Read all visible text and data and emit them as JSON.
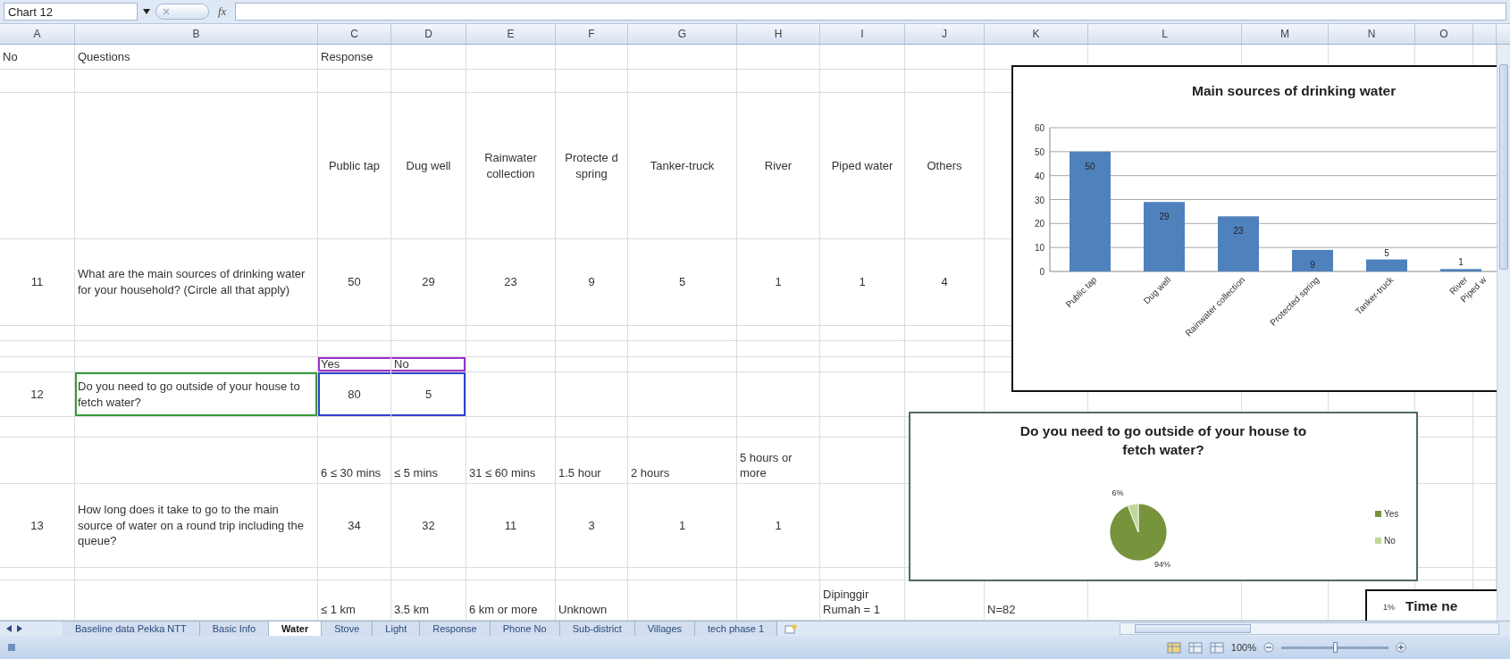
{
  "formula_bar": {
    "name_box": "Chart 12",
    "function_label": "fx"
  },
  "sheet": {
    "columns": [
      "A",
      "B",
      "C",
      "D",
      "E",
      "F",
      "G",
      "H",
      "I",
      "J",
      "K",
      "L",
      "M",
      "N",
      "O"
    ],
    "rows": [
      {
        "kind": "title",
        "A": "No",
        "B": "Questions",
        "C": "Response"
      },
      {
        "kind": "blank"
      },
      {
        "kind": "options",
        "C": "Public tap",
        "D": "Dug well",
        "E": "Rainwater collection",
        "F": "Protecte d spring",
        "G": "Tanker-truck",
        "H": "River",
        "I": "Piped water",
        "J": "Others"
      },
      {
        "kind": "answers",
        "A": "11",
        "B": "What are the main sources of drinking water for your household? (Circle all that apply)",
        "C": "50",
        "D": "29",
        "E": "23",
        "F": "9",
        "G": "5",
        "H": "1",
        "I": "1",
        "J": "4"
      },
      {
        "kind": "blank"
      },
      {
        "kind": "blank"
      },
      {
        "kind": "options_top",
        "C": "Yes",
        "D": "No",
        "highlight": {
          "C": {
            "color": "#9b30c8"
          },
          "D": {
            "color": "#9b30c8"
          }
        }
      },
      {
        "kind": "answers",
        "A": "12",
        "B": "Do you need to go outside of your house to fetch water?",
        "C": "80",
        "D": "5",
        "highlight": {
          "B": {
            "color": "#3a9a3a"
          },
          "C": {
            "color": "#3040d0"
          },
          "D": {
            "color": "#3040d0"
          }
        }
      },
      {
        "kind": "blank"
      },
      {
        "kind": "options_bottom",
        "C": "6 ≤ 30 mins",
        "D": "≤ 5 mins",
        "E": "31 ≤ 60 mins",
        "F": "1.5 hour",
        "G": "2 hours",
        "H": "5 hours or more"
      },
      {
        "kind": "answers",
        "A": "13",
        "B": "How long does it take to go to the main source of water on a round trip including the queue?",
        "C": "34",
        "D": "32",
        "E": "11",
        "F": "3",
        "G": "1",
        "H": "1"
      },
      {
        "kind": "blank"
      },
      {
        "kind": "options_bottom",
        "C": "≤ 1 km",
        "D": "3.5 km",
        "E": "6 km or more",
        "F": "Unknown",
        "I": "Dipinggir Rumah = 1",
        "K": "N=82"
      }
    ],
    "bar_chart": {
      "chart_data": {
        "type": "bar",
        "title": "Main sources of drinking water",
        "categories": [
          "Public tap",
          "Dug well",
          "Rainwater collection",
          "Protected spring",
          "Tanker-truck",
          "River",
          "Piped w"
        ],
        "series": [
          {
            "color": "#4f81bd",
            "values": [
              50,
              29,
              23,
              9,
              5,
              1,
              null
            ]
          }
        ],
        "ylim": [
          0,
          60
        ],
        "yticks": [
          0,
          10,
          20,
          30,
          40,
          50,
          60
        ],
        "grid": true,
        "value_labels": [
          "50",
          "29",
          "23",
          "9",
          "5",
          "1"
        ]
      }
    },
    "pie_chart": {
      "chart_data": {
        "type": "pie",
        "title": "Do you need to go outside of your house to fetch water?",
        "categories": [
          "Yes",
          "No"
        ],
        "values": [
          94,
          6
        ],
        "colors": [
          "#77933c",
          "#c3d69b"
        ],
        "value_labels": [
          "94%",
          "6%"
        ],
        "legend": true
      }
    },
    "third_chart": {
      "title": "Time ne",
      "label": "1%"
    }
  },
  "sheet_tabs": [
    {
      "label": "Baseline data Pekka NTT",
      "selected": false
    },
    {
      "label": "Basic Info",
      "selected": false
    },
    {
      "label": "Water",
      "selected": true
    },
    {
      "label": "Stove",
      "selected": false
    },
    {
      "label": "Light",
      "selected": false
    },
    {
      "label": "Response",
      "selected": false
    },
    {
      "label": "Phone No",
      "selected": false
    },
    {
      "label": "Sub-district",
      "selected": false
    },
    {
      "label": "Villages",
      "selected": false
    },
    {
      "label": "tech phase 1",
      "selected": false
    }
  ],
  "status_bar": {
    "zoom": "100%",
    "zoom_slider": {
      "level": 0.5
    }
  }
}
